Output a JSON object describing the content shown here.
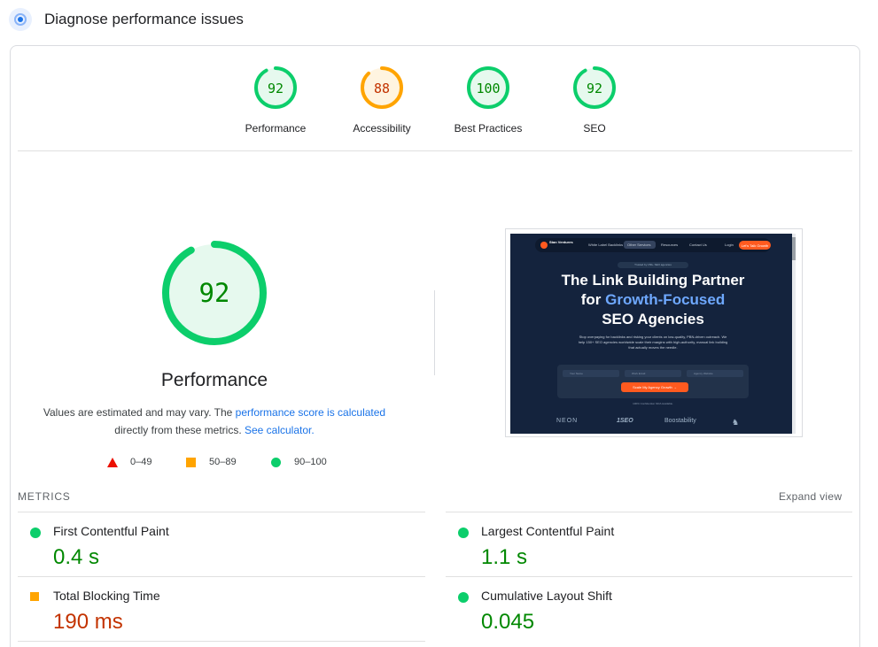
{
  "header": {
    "title": "Diagnose performance issues",
    "icon": "lighthouse-icon"
  },
  "categories": [
    {
      "label": "Performance",
      "score": "92",
      "score_value": 92,
      "color": "#0cce6b",
      "text_color": "#008800",
      "bg": "#e6f9ee"
    },
    {
      "label": "Accessibility",
      "score": "88",
      "score_value": 88,
      "color": "#ffa400",
      "text_color": "#c33300",
      "bg": "#fff4e0"
    },
    {
      "label": "Best Practices",
      "score": "100",
      "score_value": 100,
      "color": "#0cce6b",
      "text_color": "#008800",
      "bg": "#e6f9ee"
    },
    {
      "label": "SEO",
      "score": "92",
      "score_value": 92,
      "color": "#0cce6b",
      "text_color": "#008800",
      "bg": "#e6f9ee"
    }
  ],
  "main": {
    "score": "92",
    "score_value": 92,
    "title": "Performance",
    "note_text_1": "Values are estimated and may vary. The ",
    "note_link_1": "performance score is calculated",
    "note_text_2": " directly from these metrics. ",
    "note_link_2": "See calculator."
  },
  "legend": [
    {
      "range": "0–49",
      "shape": "triangle",
      "color": "#eb0f00"
    },
    {
      "range": "50–89",
      "shape": "square",
      "color": "#ffa400"
    },
    {
      "range": "90–100",
      "shape": "circle",
      "color": "#0cce6b"
    }
  ],
  "screenshot": {
    "brand": "Stan Ventures",
    "nav_links": [
      "White Label Backlinks",
      "Other Services",
      "Resources",
      "Contact Us",
      "Login"
    ],
    "nav_cta": "Let's Talk Growth",
    "tag": "Trusted by 150+ SEO agencies",
    "hero_line_1": "The Link Building Partner",
    "hero_line_2_a": "for ",
    "hero_line_2_b": "Growth-Focused",
    "hero_line_3": "SEO Agencies",
    "subtext": "Stop overpaying for backlinks and risking your clients on low-quality, PBN-driven outreach. We help 150+ SEO agencies worldwide scale their margins with high-authority, manual link building that actually moves the needle.",
    "form_fields": [
      "Your Name",
      "Work Email",
      "Agency Website"
    ],
    "form_button": "Scale My Agency Growth →",
    "fine_print": "100% Confidential. NDA Available.",
    "logos": [
      "NEON",
      "1SEO",
      "Boostability",
      "bull-logo"
    ]
  },
  "metrics": {
    "title": "METRICS",
    "expand_label": "Expand view",
    "items": [
      {
        "name": "First Contentful Paint",
        "value": "0.4 s",
        "status": "good"
      },
      {
        "name": "Largest Contentful Paint",
        "value": "1.1 s",
        "status": "good"
      },
      {
        "name": "Total Blocking Time",
        "value": "190 ms",
        "status": "average"
      },
      {
        "name": "Cumulative Layout Shift",
        "value": "0.045",
        "status": "good"
      }
    ]
  }
}
